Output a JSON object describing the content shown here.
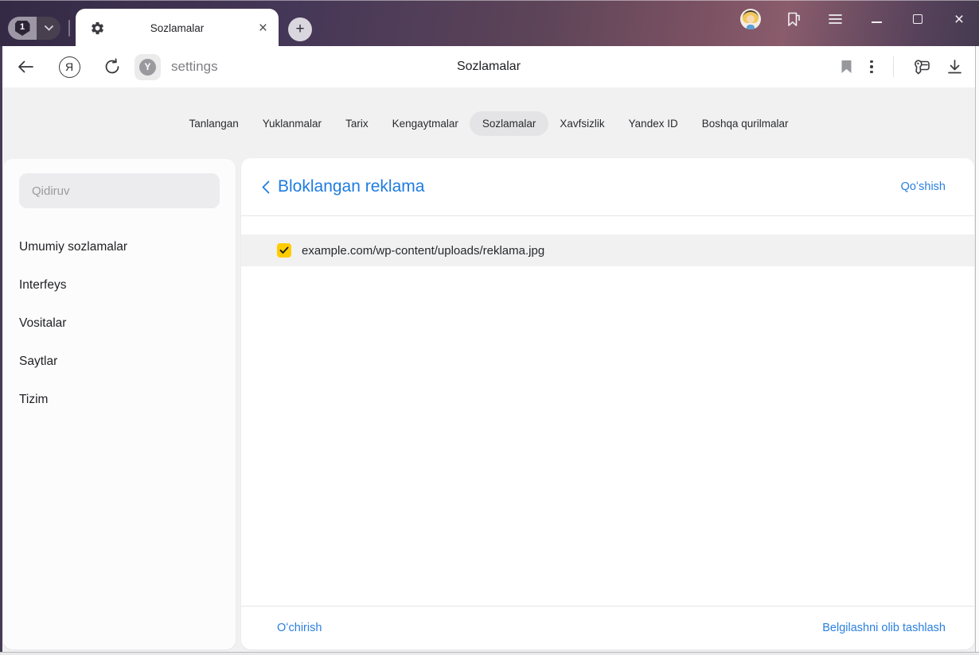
{
  "chrome": {
    "tab_count": "1",
    "tab_title": "Sozlamalar",
    "new_tab_glyph": "+",
    "close_tab_glyph": "×",
    "close_window_glyph": "×",
    "page_title": "Sozlamalar",
    "address_value": "settings",
    "site_badge_letter": "Y",
    "yandex_logo_letter": "Я"
  },
  "icons": {
    "tab_favicon": "gear-icon",
    "toolbar_left": [
      "back-arrow-icon",
      "yandex-logo-icon",
      "refresh-icon"
    ],
    "toolbar_right": [
      "bookmark-icon",
      "kebab-menu-icon",
      "passwords-key-icon",
      "download-icon"
    ],
    "chrome_right": [
      "profile-avatar",
      "collections-flag-icon",
      "hamburger-menu-icon",
      "minimize-icon",
      "maximize-icon",
      "close-icon"
    ]
  },
  "nav": {
    "items": [
      "Tanlangan",
      "Yuklanmalar",
      "Tarix",
      "Kengaytmalar",
      "Sozlamalar",
      "Xavfsizlik",
      "Yandex ID",
      "Boshqa qurilmalar"
    ],
    "active": "Sozlamalar"
  },
  "sidebar": {
    "search_placeholder": "Qidiruv",
    "items": [
      "Umumiy sozlamalar",
      "Interfeys",
      "Vositalar",
      "Saytlar",
      "Tizim"
    ]
  },
  "main": {
    "title": "Bloklangan reklama",
    "add_link": "Qoʻshish",
    "rows": [
      {
        "url": "example.com/wp-content/uploads/reklama.jpg",
        "checked": true
      }
    ],
    "footer": {
      "delete_link": "Oʻchirish",
      "clear_selection_link": "Belgilashni olib tashlash"
    }
  },
  "colors": {
    "accent_blue": "#1e7ce0",
    "checkbox_yellow": "#ffcc00",
    "chrome_dark": "#342a45",
    "chrome_mauve": "#7c5263",
    "nav_bg": "#f1f1f2",
    "selected_pill": "#e4e4e6"
  }
}
